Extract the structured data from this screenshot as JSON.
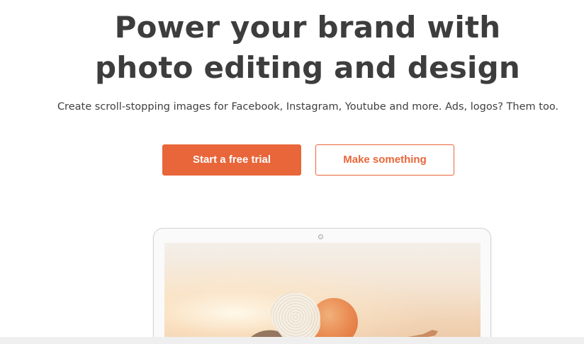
{
  "hero": {
    "title_line1": "Power your brand with",
    "title_line2": "photo editing and design",
    "subtitle": "Create scroll-stopping images for Facebook, Instagram, Youtube and more. Ads, logos? Them too."
  },
  "actions": {
    "primary_label": "Start a free trial",
    "secondary_label": "Make something"
  },
  "colors": {
    "accent": "#e8663a",
    "heading": "#3d3d3d",
    "body_text": "#3f3f3f"
  }
}
